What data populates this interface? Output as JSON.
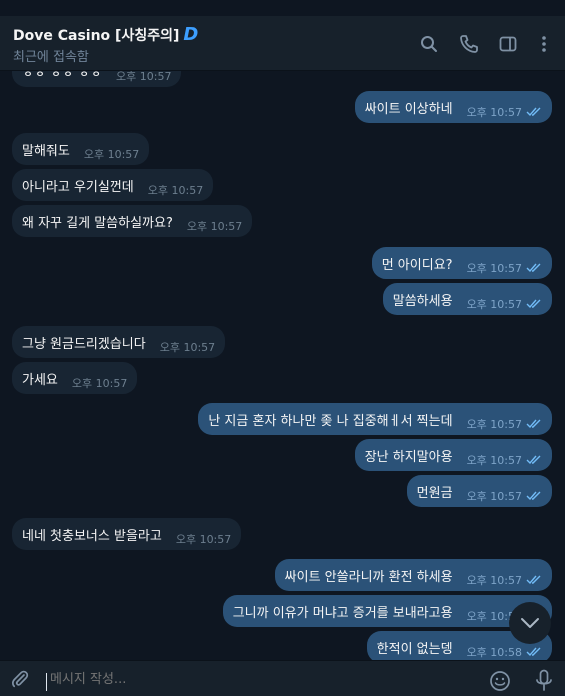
{
  "chat": {
    "title": "Dove Casino [사칭주의]",
    "badge": "D",
    "status": "최근에 접속함"
  },
  "header_icons": [
    "search-icon",
    "phone-icon",
    "sidebar-icon",
    "more-icon"
  ],
  "messages": [
    {
      "dir": "in",
      "text": "ㅎㅎ ㅎㅎ ㅎㅎ",
      "time": "오후 10:57"
    },
    {
      "dir": "out",
      "text": "싸이트 이상하네",
      "time": "오후 10:57"
    },
    {
      "dir": "in",
      "text": "말해줘도",
      "time": "오후 10:57"
    },
    {
      "dir": "in",
      "text": "아니라고 우기실껀데",
      "time": "오후 10:57"
    },
    {
      "dir": "in",
      "text": "왜 자꾸 길게 말씀하실까요?",
      "time": "오후 10:57"
    },
    {
      "dir": "out",
      "text": "먼 아이디요?",
      "time": "오후 10:57"
    },
    {
      "dir": "out",
      "text": "말씀하세용",
      "time": "오후 10:57"
    },
    {
      "dir": "in",
      "text": "그냥 원금드리겠습니다",
      "time": "오후 10:57"
    },
    {
      "dir": "in",
      "text": "가세요",
      "time": "오후 10:57"
    },
    {
      "dir": "out",
      "text": "난 지금 혼자 하나만 좆 나  집중해ㅔ서 찍는데",
      "time": "오후 10:57"
    },
    {
      "dir": "out",
      "text": "장난 하지말아용",
      "time": "오후 10:57"
    },
    {
      "dir": "out",
      "text": "먼원금",
      "time": "오후 10:57"
    },
    {
      "dir": "in",
      "text": "네네 첫충보너스 받을라고",
      "time": "오후 10:57"
    },
    {
      "dir": "out",
      "text": "싸이트  안쓸라니까 환전 하세용",
      "time": "오후 10:57"
    },
    {
      "dir": "out",
      "text": "그니까 이유가 머냐고 증거를 보내라고용",
      "time": "오후 10:58"
    },
    {
      "dir": "out",
      "text": "한적이 없는뎅",
      "time": "오후 10:58"
    }
  ],
  "composer": {
    "placeholder": "메시지 작성..."
  },
  "colors": {
    "bg": "#0e1621",
    "in": "#182533",
    "out": "#2b5278",
    "accent": "#3d9fff"
  }
}
